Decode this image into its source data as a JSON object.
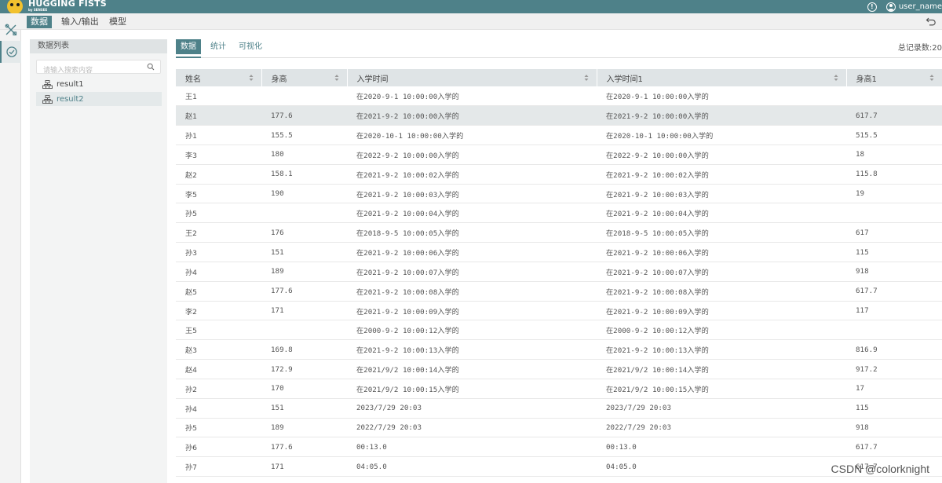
{
  "header": {
    "logo_text": "HUGGING FISTS",
    "logo_sub": "by SENSEE",
    "user_name": "user_name"
  },
  "menu": {
    "items": [
      "数据",
      "输入/输出",
      "模型"
    ],
    "active_index": 0
  },
  "sidebar": {
    "title": "数据列表",
    "search_placeholder": "请输入搜索内容",
    "items": [
      {
        "label": "result1",
        "selected": false
      },
      {
        "label": "result2",
        "selected": true
      }
    ]
  },
  "tabs": {
    "items": [
      "数据",
      "统计",
      "可视化"
    ],
    "active_index": 0,
    "total_label": "总记录数:20"
  },
  "table": {
    "columns": [
      "姓名",
      "身高",
      "入学时间",
      "入学时间1",
      "身高1"
    ],
    "highlighted_row": 1,
    "rows": [
      [
        "王1",
        "",
        "在2020-9-1 10:00:00入学的",
        "在2020-9-1 10:00:00入学的",
        ""
      ],
      [
        "赵1",
        "177.6",
        "在2021-9-2 10:00:00入学的",
        "在2021-9-2 10:00:00入学的",
        "617.7"
      ],
      [
        "孙1",
        "155.5",
        "在2020-10-1 10:00:00入学的",
        "在2020-10-1 10:00:00入学的",
        "515.5"
      ],
      [
        "李3",
        "180",
        "在2022-9-2 10:00:00入学的",
        "在2022-9-2 10:00:00入学的",
        "18"
      ],
      [
        "赵2",
        "158.1",
        "在2021-9-2 10:00:02入学的",
        "在2021-9-2 10:00:02入学的",
        "115.8"
      ],
      [
        "李5",
        "190",
        "在2021-9-2 10:00:03入学的",
        "在2021-9-2 10:00:03入学的",
        "19"
      ],
      [
        "孙5",
        "",
        "在2021-9-2 10:00:04入学的",
        "在2021-9-2 10:00:04入学的",
        ""
      ],
      [
        "王2",
        "176",
        "在2018-9-5 10:00:05入学的",
        "在2018-9-5 10:00:05入学的",
        "617"
      ],
      [
        "孙3",
        "151",
        "在2021-9-2 10:00:06入学的",
        "在2021-9-2 10:00:06入学的",
        "115"
      ],
      [
        "孙4",
        "189",
        "在2021-9-2 10:00:07入学的",
        "在2021-9-2 10:00:07入学的",
        "918"
      ],
      [
        "赵5",
        "177.6",
        "在2021-9-2 10:00:08入学的",
        "在2021-9-2 10:00:08入学的",
        "617.7"
      ],
      [
        "李2",
        "171",
        "在2021-9-2 10:00:09入学的",
        "在2021-9-2 10:00:09入学的",
        "117"
      ],
      [
        "王5",
        "",
        "在2000-9-2 10:00:12入学的",
        "在2000-9-2 10:00:12入学的",
        ""
      ],
      [
        "赵3",
        "169.8",
        "在2021-9-2 10:00:13入学的",
        "在2021-9-2 10:00:13入学的",
        "816.9"
      ],
      [
        "赵4",
        "172.9",
        "在2021/9/2 10:00:14入学的",
        "在2021/9/2 10:00:14入学的",
        "917.2"
      ],
      [
        "孙2",
        "170",
        "在2021/9/2 10:00:15入学的",
        "在2021/9/2 10:00:15入学的",
        "17"
      ],
      [
        "孙4",
        "151",
        "2023/7/29 20:03",
        "2023/7/29 20:03",
        "115"
      ],
      [
        "孙5",
        "189",
        "2022/7/29 20:03",
        "2022/7/29 20:03",
        "918"
      ],
      [
        "孙6",
        "177.6",
        "00:13.0",
        "00:13.0",
        "617.7"
      ],
      [
        "孙7",
        "171",
        "04:05.0",
        "04:05.0",
        "617.7"
      ]
    ]
  },
  "watermark": "CSDN @colorknight",
  "colors": {
    "brand": "#4e8189",
    "logo_yellow": "#f2c12e",
    "header_bg": "#dfe4e6",
    "selected_bg": "#e4e8e9"
  },
  "icons": {
    "rail": [
      "tools-icon",
      "check-circle-icon"
    ],
    "topbar": [
      "alert-icon",
      "user-icon"
    ],
    "menubar": [
      "undo-icon"
    ],
    "sidebar": [
      "search-icon",
      "dataset-icon"
    ]
  }
}
